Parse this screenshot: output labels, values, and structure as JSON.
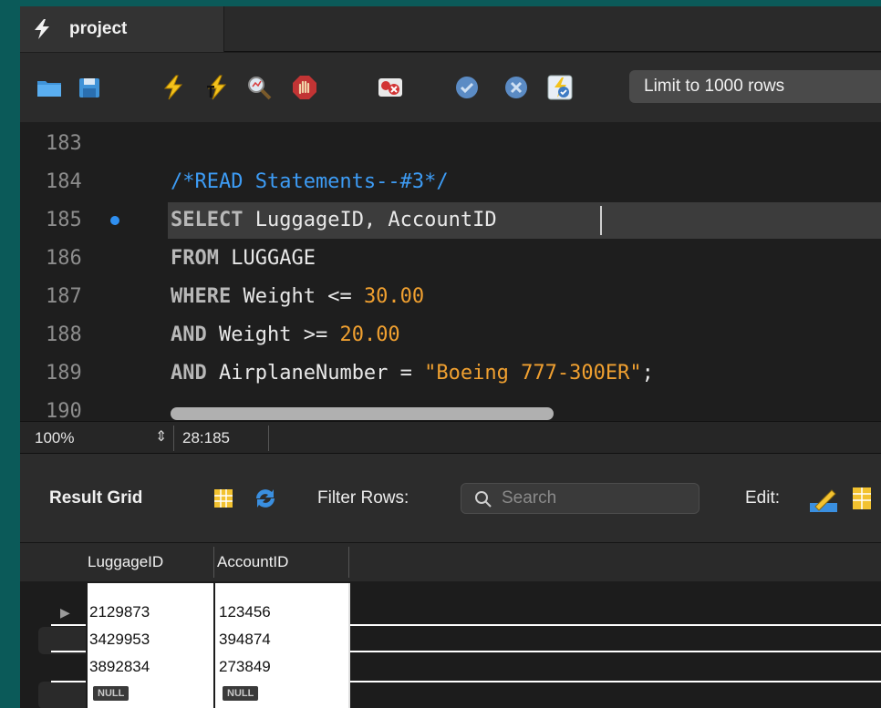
{
  "tab": {
    "title": "project"
  },
  "toolbar": {
    "icons": [
      "open-folder-icon",
      "save-icon",
      "execute-icon",
      "execute-current-icon",
      "explain-icon",
      "stop-icon",
      "toggle-error-icon",
      "commit-icon",
      "rollback-icon",
      "autocommit-icon"
    ],
    "limit_label": "Limit to 1000 rows"
  },
  "editor": {
    "lines": [
      {
        "num": "183"
      },
      {
        "num": "184"
      },
      {
        "num": "185"
      },
      {
        "num": "186"
      },
      {
        "num": "187"
      },
      {
        "num": "188"
      },
      {
        "num": "189"
      },
      {
        "num": "190"
      }
    ],
    "comment": "/*READ Statements--#3*/",
    "l185_kw": "SELECT",
    "l185_rest": " LuggageID, AccountID",
    "l186_kw": "FROM",
    "l186_rest": " LUGGAGE",
    "l187_kw": "WHERE",
    "l187_a": " Weight <= ",
    "l187_num": "30.00",
    "l188_kw": "AND",
    "l188_a": " Weight >= ",
    "l188_num": "20.00",
    "l189_kw": "AND",
    "l189_a": " AirplaneNumber = ",
    "l189_str": "\"Boeing 777-300ER\"",
    "l189_end": ";"
  },
  "status": {
    "zoom": "100%",
    "position": "28:185"
  },
  "result": {
    "title": "Result Grid",
    "filter_label": "Filter Rows:",
    "search_placeholder": "Search",
    "edit_label": "Edit:",
    "columns": [
      "LuggageID",
      "AccountID"
    ],
    "rows": [
      [
        "2129873",
        "123456"
      ],
      [
        "3429953",
        "394874"
      ],
      [
        "3892834",
        "273849"
      ],
      [
        "NULL",
        "NULL"
      ]
    ]
  },
  "colors": {
    "comment": "#3d9cf5",
    "number": "#f0a030",
    "background": "#1e1e1e",
    "frame": "#0b5a59"
  }
}
